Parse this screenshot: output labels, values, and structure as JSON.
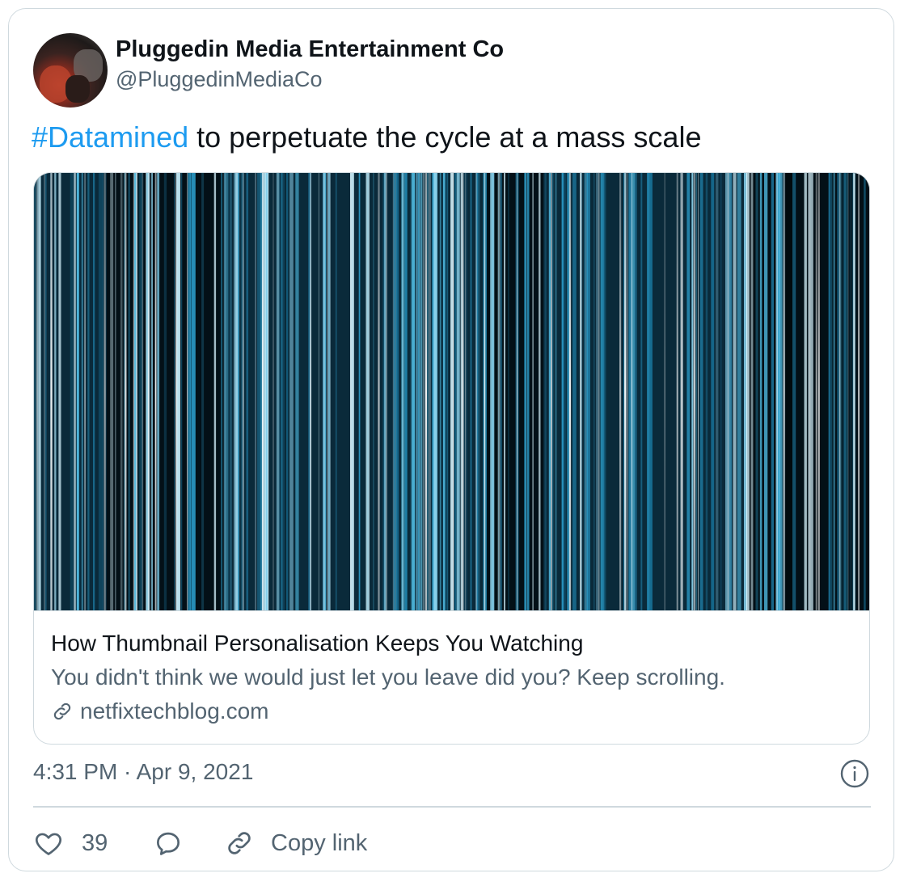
{
  "author": {
    "display_name": "Pluggedin Media Entertainment Co",
    "handle": "@PluggedinMediaCo",
    "avatar_icon": "profile-photo"
  },
  "tweet": {
    "hashtag": "#Datamined",
    "text": " to perpetuate the cycle at a mass scale",
    "hashtag_color": "#1d9bf0"
  },
  "link_card": {
    "title": "How Thumbnail Personalisation Keeps You Watching",
    "description": "You didn't think we would just let you leave did you? Keep scrolling.",
    "domain": "netfixtechblog.com",
    "domain_icon": "link-icon",
    "image_theme": "blue vertical light streaks on dark background"
  },
  "meta": {
    "timestamp": "4:31 PM · Apr 9, 2021",
    "info_icon": "info-icon"
  },
  "actions": {
    "like_icon": "heart-icon",
    "like_count": "39",
    "reply_icon": "reply-bubble-icon",
    "copy_icon": "link-icon",
    "copy_label": "Copy link"
  },
  "colors": {
    "text_primary": "#0f1419",
    "text_secondary": "#536471",
    "accent": "#1d9bf0",
    "border": "#cfd9de"
  }
}
